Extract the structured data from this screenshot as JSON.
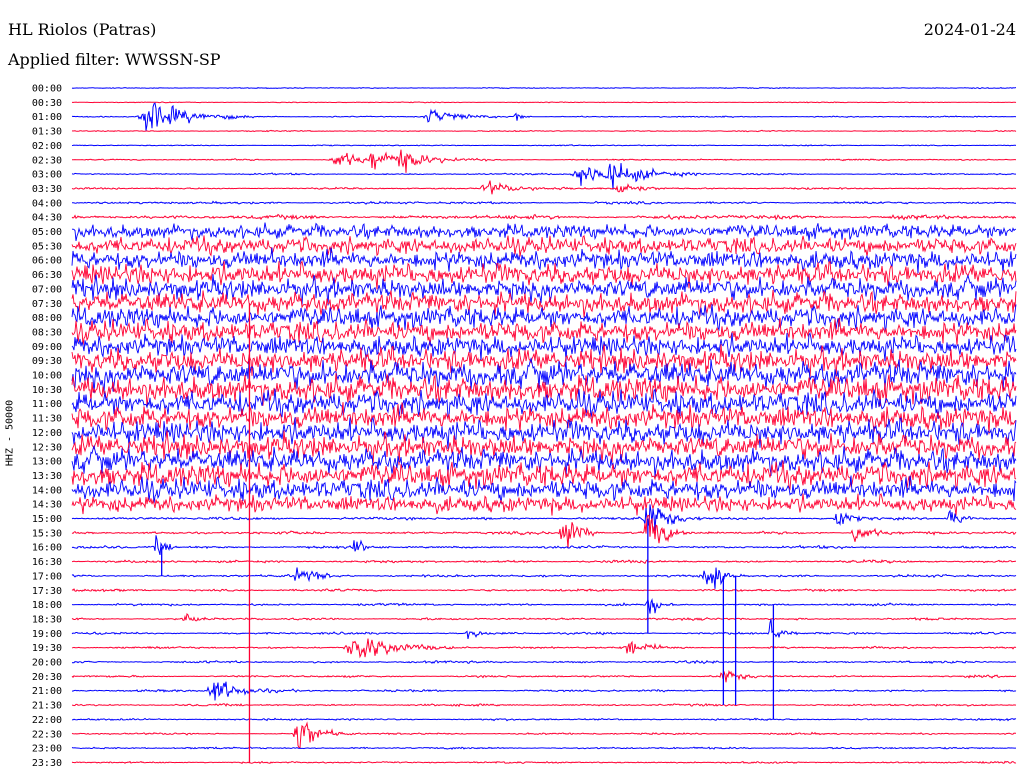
{
  "header": {
    "station": "HL Riolos (Patras)",
    "date": "2024-01-24",
    "filter": "Applied filter: WWSSN-SP",
    "channel": "HHZ - 50000"
  },
  "colors": {
    "even": "#0000ff",
    "odd": "#ff0033"
  },
  "chart_data": {
    "type": "line",
    "title": "HL Riolos (Patras)",
    "ylabel": "HHZ - 50000",
    "series_labels": [
      "00:00",
      "00:30",
      "01:00",
      "01:30",
      "02:00",
      "02:30",
      "03:00",
      "03:30",
      "04:00",
      "04:30",
      "05:00",
      "05:30",
      "06:00",
      "06:30",
      "07:00",
      "07:30",
      "08:00",
      "08:30",
      "09:00",
      "09:30",
      "10:00",
      "10:30",
      "11:00",
      "11:30",
      "12:00",
      "12:30",
      "13:00",
      "13:30",
      "14:00",
      "14:30",
      "15:00",
      "15:30",
      "16:00",
      "16:30",
      "17:00",
      "17:30",
      "18:00",
      "18:30",
      "19:00",
      "19:30",
      "20:00",
      "20:30",
      "21:00",
      "21:30",
      "22:00",
      "22:30",
      "23:00",
      "23:30"
    ],
    "noise_level": [
      0.5,
      0.5,
      0.7,
      0.6,
      0.6,
      0.8,
      0.8,
      0.9,
      1.3,
      2.2,
      6,
      7,
      8,
      9,
      9,
      9,
      9,
      9,
      9,
      10,
      11,
      11,
      10,
      10,
      10,
      10,
      10,
      10,
      9,
      7,
      1.5,
      1.5,
      1.4,
      1.4,
      1.3,
      1.3,
      1.2,
      1.2,
      1.2,
      1.2,
      1.2,
      1.1,
      1.1,
      1.1,
      1.0,
      1.0,
      1.0,
      1.0
    ],
    "events": [
      {
        "row": 2,
        "x": 0.08,
        "w": 0.04,
        "amp": 18
      },
      {
        "row": 2,
        "x": 0.38,
        "w": 0.03,
        "amp": 7
      },
      {
        "row": 2,
        "x": 0.47,
        "w": 0.006,
        "amp": 8
      },
      {
        "row": 5,
        "x": 0.28,
        "w": 0.03,
        "amp": 8
      },
      {
        "row": 5,
        "x": 0.32,
        "w": 0.03,
        "amp": 9
      },
      {
        "row": 5,
        "x": 0.35,
        "w": 0.03,
        "amp": 7
      },
      {
        "row": 6,
        "x": 0.54,
        "w": 0.04,
        "amp": 10
      },
      {
        "row": 6,
        "x": 0.57,
        "w": 0.04,
        "amp": 9
      },
      {
        "row": 7,
        "x": 0.44,
        "w": 0.03,
        "amp": 7
      },
      {
        "row": 7,
        "x": 0.58,
        "w": 0.02,
        "amp": 8
      },
      {
        "row": 30,
        "x": 0.61,
        "w": 0.02,
        "amp": 22
      },
      {
        "row": 30,
        "x": 0.81,
        "w": 0.01,
        "amp": 12
      },
      {
        "row": 30,
        "x": 0.93,
        "w": 0.01,
        "amp": 12
      },
      {
        "row": 31,
        "x": 0.52,
        "w": 0.015,
        "amp": 26
      },
      {
        "row": 31,
        "x": 0.61,
        "w": 0.015,
        "amp": 28
      },
      {
        "row": 31,
        "x": 0.83,
        "w": 0.015,
        "amp": 12
      },
      {
        "row": 32,
        "x": 0.09,
        "w": 0.01,
        "amp": 12
      },
      {
        "row": 32,
        "x": 0.3,
        "w": 0.01,
        "amp": 8
      },
      {
        "row": 34,
        "x": 0.24,
        "w": 0.02,
        "amp": 9
      },
      {
        "row": 34,
        "x": 0.67,
        "w": 0.01,
        "amp": 10
      },
      {
        "row": 34,
        "x": 0.68,
        "w": 0.01,
        "amp": 12
      },
      {
        "row": 36,
        "x": 0.61,
        "w": 0.01,
        "amp": 14
      },
      {
        "row": 37,
        "x": 0.12,
        "w": 0.01,
        "amp": 6
      },
      {
        "row": 38,
        "x": 0.42,
        "w": 0.01,
        "amp": 6
      },
      {
        "row": 38,
        "x": 0.74,
        "w": 0.01,
        "amp": 14
      },
      {
        "row": 39,
        "x": 0.3,
        "w": 0.04,
        "amp": 14
      },
      {
        "row": 39,
        "x": 0.59,
        "w": 0.02,
        "amp": 8
      },
      {
        "row": 41,
        "x": 0.69,
        "w": 0.015,
        "amp": 8
      },
      {
        "row": 42,
        "x": 0.15,
        "w": 0.03,
        "amp": 12
      },
      {
        "row": 45,
        "x": 0.24,
        "w": 0.02,
        "amp": 18
      }
    ],
    "spikes": [
      {
        "x": 0.188,
        "from": 15,
        "to": 47
      },
      {
        "x": 0.61,
        "from": 30,
        "to": 38
      },
      {
        "x": 0.69,
        "from": 34,
        "to": 43
      },
      {
        "x": 0.703,
        "from": 34,
        "to": 43
      },
      {
        "x": 0.743,
        "from": 36,
        "to": 44
      },
      {
        "x": 0.095,
        "from": 32,
        "to": 34
      }
    ]
  }
}
